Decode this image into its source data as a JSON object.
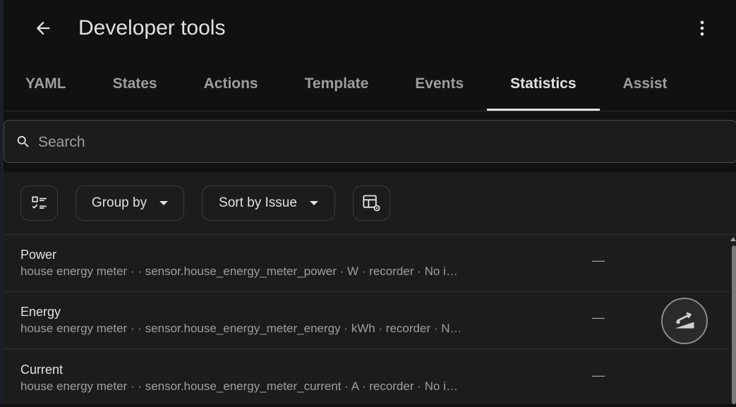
{
  "header": {
    "title": "Developer tools",
    "back_icon": "arrow-left-icon",
    "menu_icon": "dots-vertical-icon"
  },
  "tabs": [
    {
      "label": "YAML",
      "active": false
    },
    {
      "label": "States",
      "active": false
    },
    {
      "label": "Actions",
      "active": false
    },
    {
      "label": "Template",
      "active": false
    },
    {
      "label": "Events",
      "active": false
    },
    {
      "label": "Statistics",
      "active": true
    },
    {
      "label": "Assist",
      "active": false
    }
  ],
  "search": {
    "placeholder": "Search",
    "value": "",
    "icon": "search-icon"
  },
  "toolbar": {
    "select_icon": "checklist-icon",
    "group_by_label": "Group by",
    "sort_label": "Sort by Issue",
    "columns_icon": "table-cog-icon"
  },
  "rows": [
    {
      "title": "Power",
      "subtitle": "house energy meter · · sensor.house_energy_meter_power · W · recorder · No i…",
      "issue": "—"
    },
    {
      "title": "Energy",
      "subtitle": "house energy meter · · sensor.house_energy_meter_energy · kWh · recorder · N…",
      "issue": "—"
    },
    {
      "title": "Current",
      "subtitle": "house energy meter · · sensor.house_energy_meter_current · A · recorder · No i…",
      "issue": "—"
    }
  ],
  "fab": {
    "icon": "scale-balance-icon"
  },
  "colors": {
    "background": "#111111",
    "surface": "#1c1c1c",
    "text_primary": "#e1e1e1",
    "text_secondary": "#9e9e9e",
    "divider": "#2e2e2e"
  }
}
